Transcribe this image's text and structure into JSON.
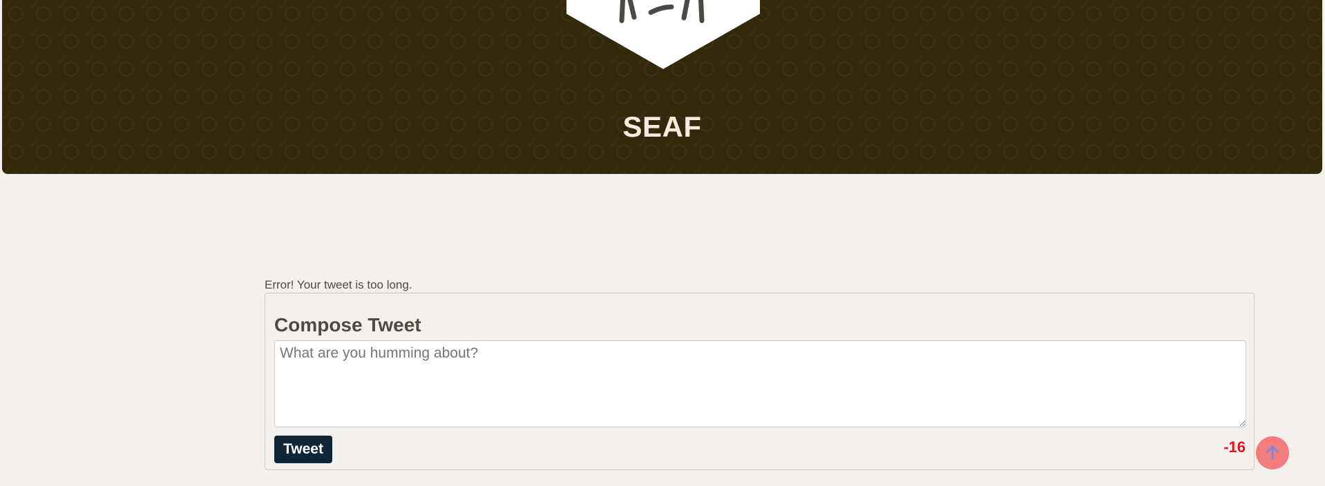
{
  "header": {
    "site_title": "SEAF",
    "logo_icon": "logo-badge-icon"
  },
  "compose": {
    "error_message": "Error! Your tweet is too long.",
    "title": "Compose Tweet",
    "input_value": "",
    "input_placeholder": "What are you humming about?",
    "submit_label": "Tweet",
    "char_count": "-16"
  },
  "scroll_top": {
    "icon": "arrow-up-icon"
  },
  "colors": {
    "header_bg": "#332809",
    "page_bg": "#f4f1ec",
    "button_bg": "#0f2538",
    "counter_error": "#e8101a",
    "scroll_button": "#f47c7c"
  }
}
